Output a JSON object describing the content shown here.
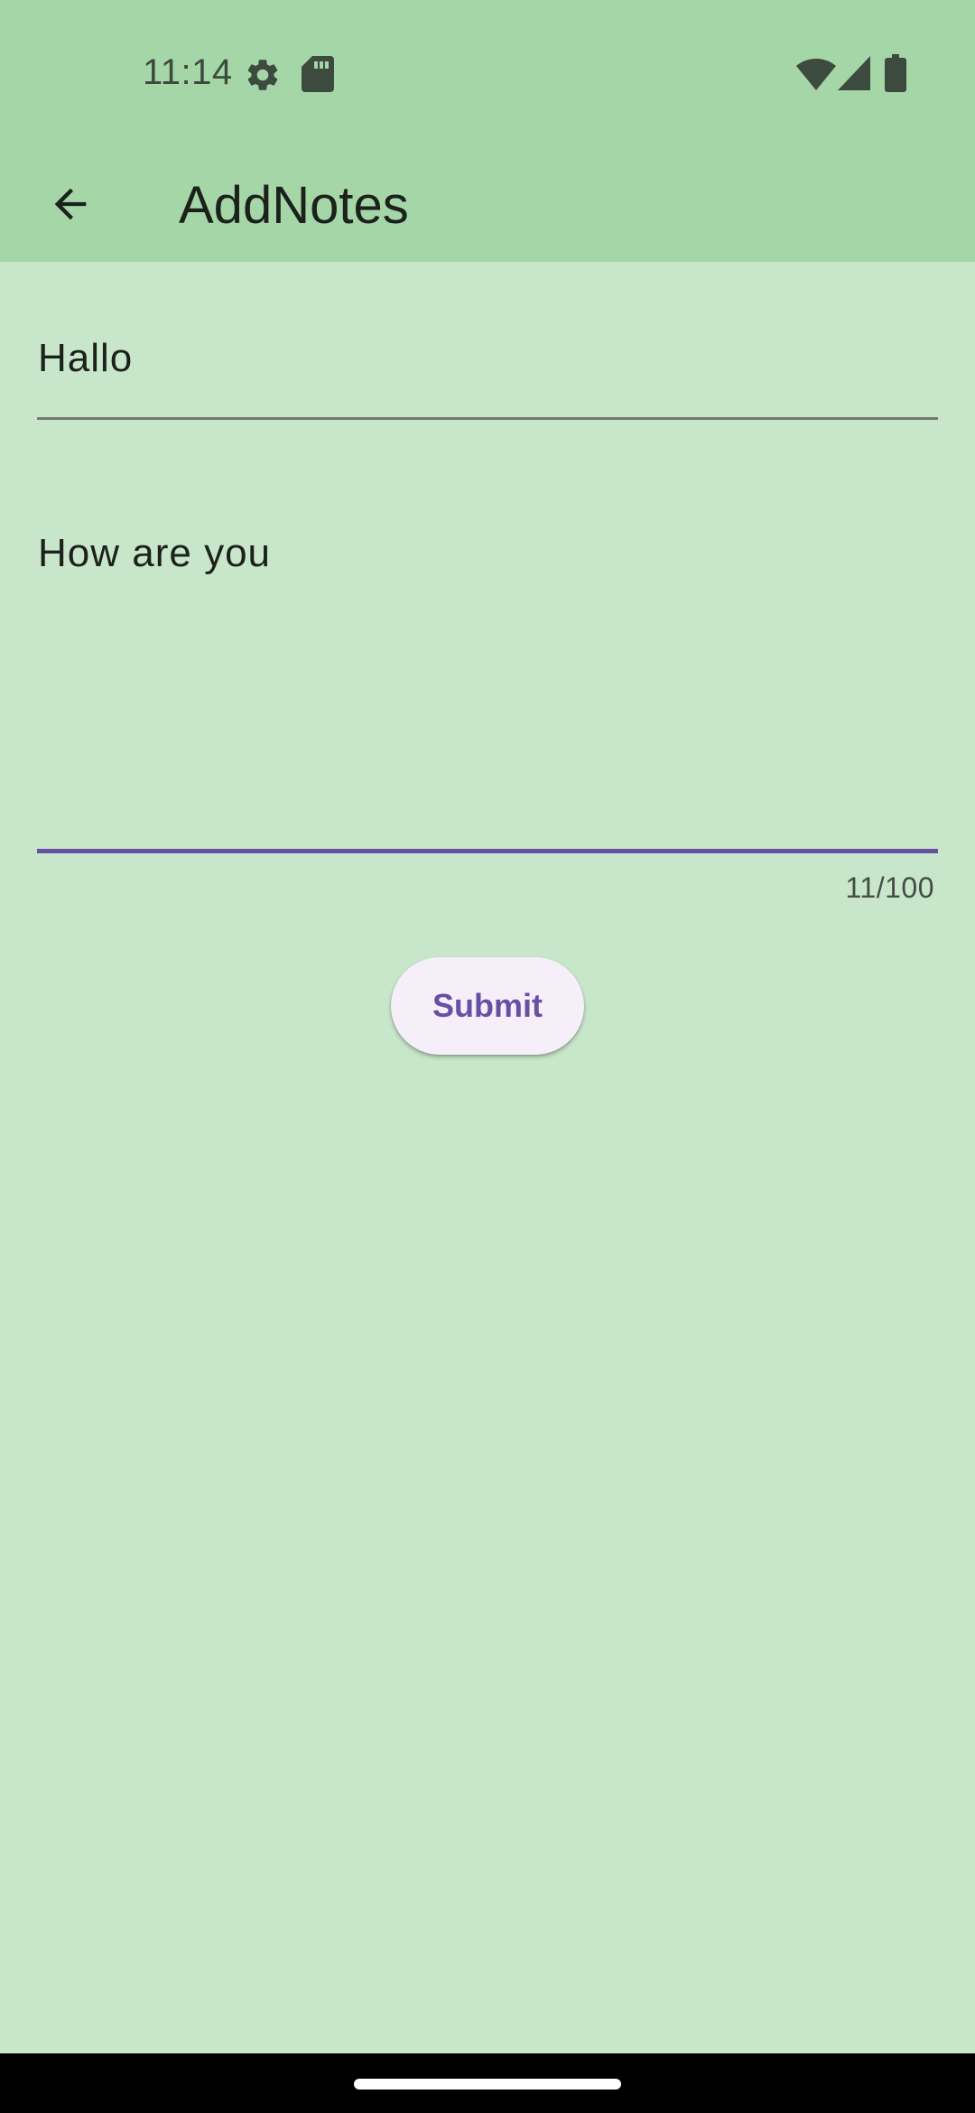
{
  "status_bar": {
    "time": "11:14",
    "icons": [
      "settings-gear-icon",
      "sd-card-icon",
      "wifi-icon",
      "cellular-signal-icon",
      "battery-icon"
    ]
  },
  "app_bar": {
    "back_icon": "arrow-back-icon",
    "title": "AddNotes"
  },
  "form": {
    "title_field": {
      "value": "Hallo"
    },
    "body_field": {
      "value": "How are you",
      "counter": "11/100"
    },
    "submit_label": "Submit"
  },
  "colors": {
    "app_bar_background": "#a5d6a7",
    "page_background": "#c8e6c9",
    "accent": "#6750a4",
    "button_background": "#f5effa"
  }
}
